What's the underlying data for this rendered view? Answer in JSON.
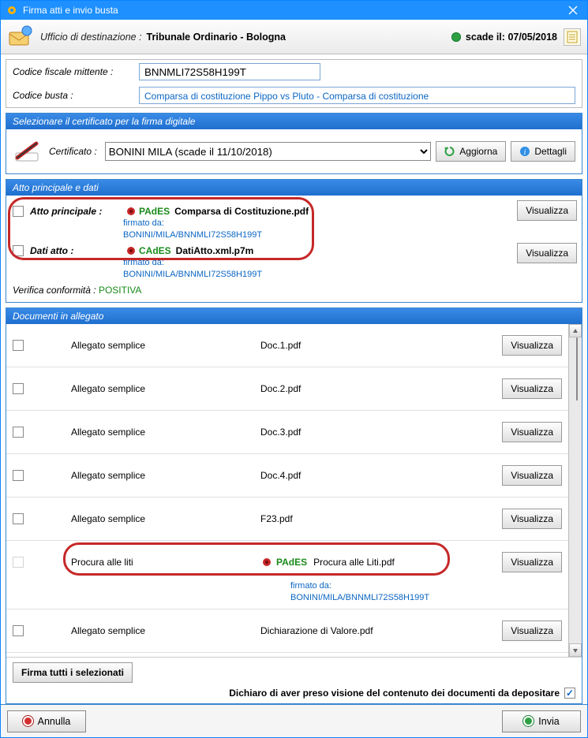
{
  "window": {
    "title": "Firma atti e invio busta"
  },
  "dest": {
    "label": "Ufficio di destinazione :",
    "value": "Tribunale Ordinario - Bologna",
    "expire_label": "scade il:",
    "expire_date": "07/05/2018"
  },
  "mittente": {
    "cf_label": "Codice fiscale mittente :",
    "cf_value": "BNNMLI72S58H199T",
    "busta_label": "Codice  busta :",
    "busta_value": "Comparsa di costituzione Pippo vs Pluto - Comparsa di costituzione"
  },
  "cert": {
    "panel_title": "Selezionare il certificato per la firma digitale",
    "label": "Certificato :",
    "selected": "BONINI MILA (scade il 11/10/2018)",
    "refresh": "Aggiorna",
    "details": "Dettagli"
  },
  "atto": {
    "panel_title": "Atto principale e dati",
    "principale_label": "Atto principale :",
    "principale_sigtype": "PAdES",
    "principale_file": "Comparsa di Costituzione.pdf",
    "dati_label": "Dati atto :",
    "dati_sigtype": "CAdES",
    "dati_file": "DatiAtto.xml.p7m",
    "firmato_da": "firmato da:",
    "signer": "BONINI/MILA/BNNMLI72S58H199T",
    "verifica_label": "Verifica conformità :",
    "verifica_value": "POSITIVA",
    "visualizza": "Visualizza"
  },
  "allegati": {
    "panel_title": "Documenti in allegato",
    "type_semplice": "Allegato semplice",
    "type_procura": "Procura alle liti",
    "sigtype_pades": "PAdES",
    "firmato_da": "firmato da:",
    "signer": "BONINI/MILA/BNNMLI72S58H199T",
    "visualizza": "Visualizza",
    "rows": {
      "r1": "Doc.1.pdf",
      "r2": "Doc.2.pdf",
      "r3": "Doc.3.pdf",
      "r4": "Doc.4.pdf",
      "r5": "F23.pdf",
      "r6": "Procura alle Liti.pdf",
      "r7": "Dichiarazione di Valore.pdf"
    },
    "firma_tutti": "Firma tutti i selezionati",
    "declare": "Dichiaro di aver preso visione del contenuto dei documenti da depositare"
  },
  "actions": {
    "cancel": "Annulla",
    "send": "Invia"
  }
}
